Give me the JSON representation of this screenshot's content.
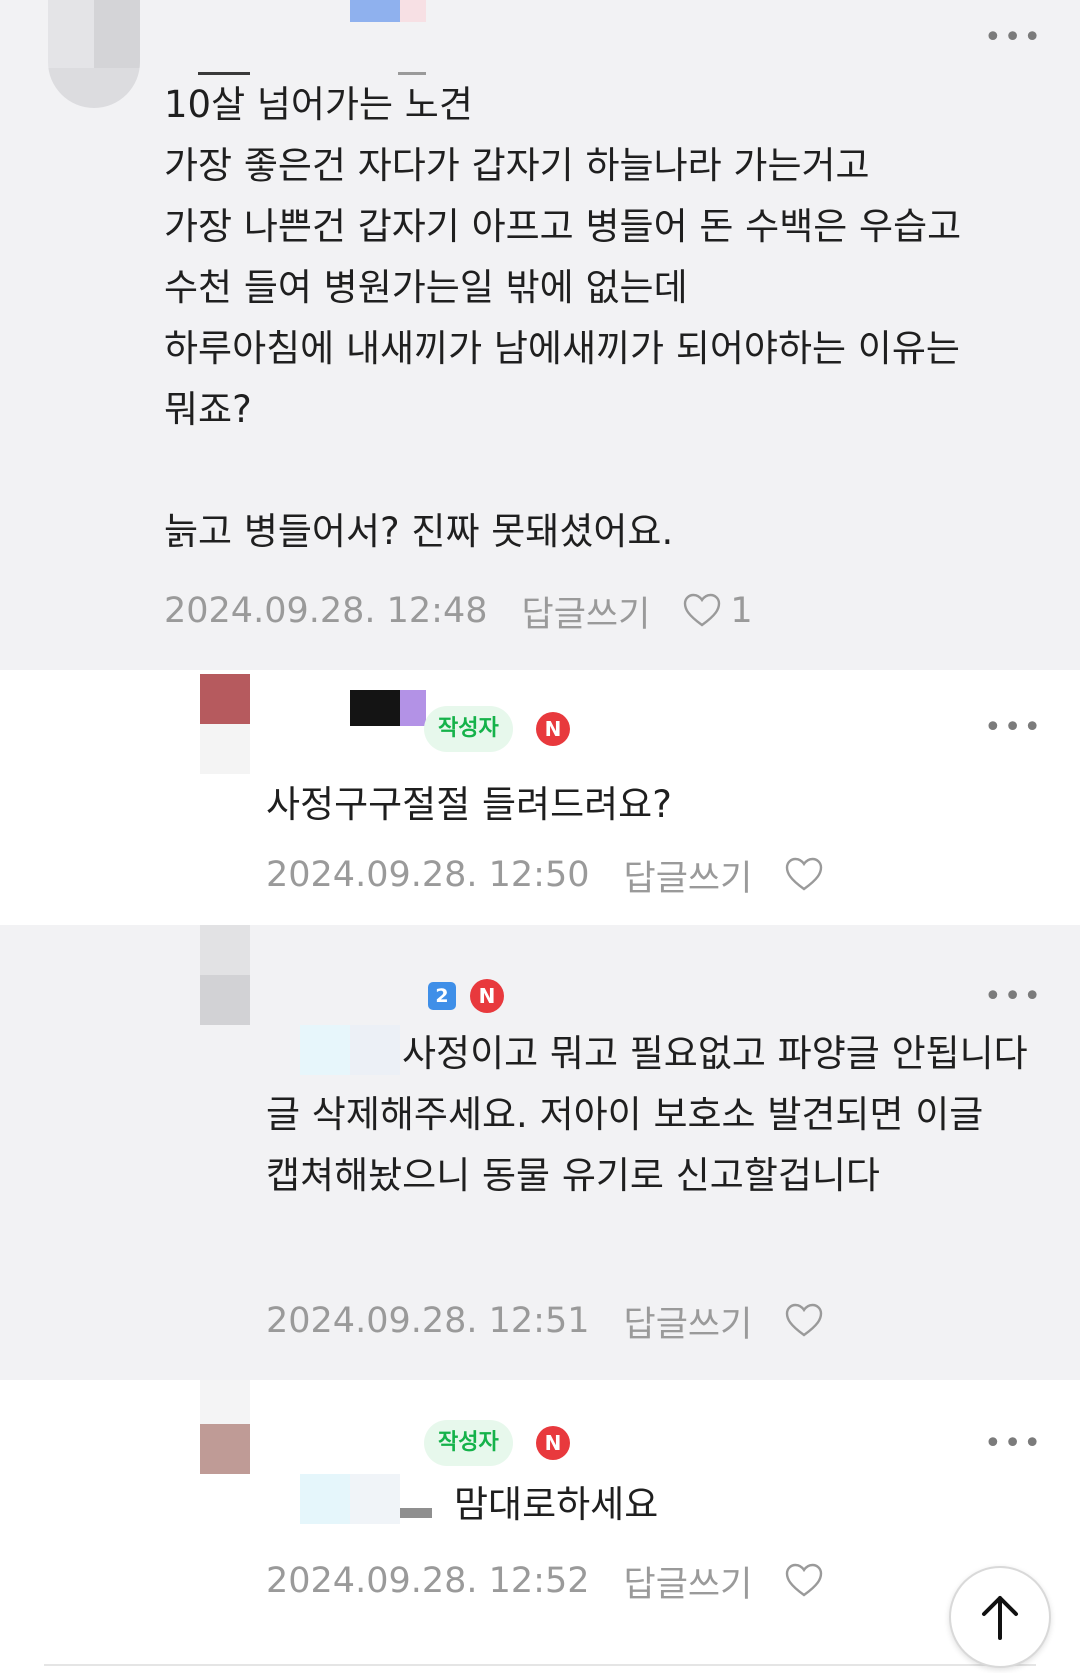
{
  "comments": [
    {
      "text": "10살 넘어가는 노견\n가장 좋은건 자다가 갑자기 하늘나라 가는거고\n가장 나쁜건 갑자기 아프고 병들어 돈 수백은 우습고 수천 들여 병원가는일 밖에 없는데\n하루아침에 내새끼가 남에새끼가 되어야하는 이유는 뭐죠?\n\n늙고 병들어서? 진짜 못돼셨어요.",
      "date": "2024.09.28. 12:48",
      "reply_label": "답글쓰기",
      "likes": "1",
      "more_label": "•••"
    },
    {
      "author_badge": "작성자",
      "n_badge": "N",
      "text": "사정구구절절 들려드려요?",
      "date": "2024.09.28. 12:50",
      "reply_label": "답글쓰기",
      "more_label": "•••"
    },
    {
      "level_badge": "2",
      "n_badge": "N",
      "text": "사정이고 뭐고 필요없고 파양글 안됩니다 글 삭제해주세요. 저아이 보호소 발견되면 이글 캡쳐해놨으니 동물 유기로 신고할겁니다",
      "date": "2024.09.28. 12:51",
      "reply_label": "답글쓰기",
      "more_label": "•••"
    },
    {
      "author_badge": "작성자",
      "n_badge": "N",
      "text": "맘대로하세요",
      "date": "2024.09.28. 12:52",
      "reply_label": "답글쓰기",
      "more_label": "•••"
    }
  ],
  "scroll_top_icon": "arrow-up-icon",
  "colors": {
    "author_badge_bg": "#e7f8ec",
    "author_badge_text": "#15b24a",
    "n_badge": "#e8393d",
    "level_badge": "#3f8fe8",
    "meta_text": "#9a9a9a",
    "comment_bg_alt": "#f2f2f4"
  }
}
